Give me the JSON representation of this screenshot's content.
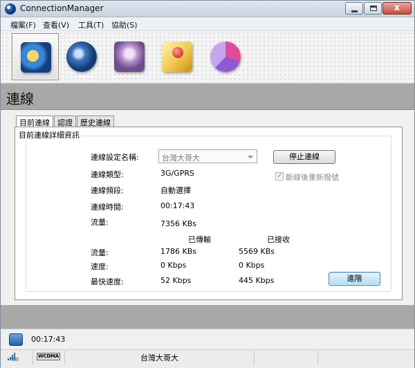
{
  "window": {
    "title": "ConnectionManager",
    "controls": {
      "close": "x"
    }
  },
  "menu": [
    "檔案(F)",
    "查看(V)",
    "工具(T)",
    "協助(S)"
  ],
  "toolbar": [
    "connection-icon",
    "authentication-icon",
    "users-icon",
    "history-icon",
    "statistics-icon"
  ],
  "section": {
    "title": "連線"
  },
  "tabs": [
    "目前連線",
    "認證",
    "歷史連線"
  ],
  "details": {
    "group_title": "目前連線詳細資訊",
    "profile_label": "連線設定名稱:",
    "profile_value": "台灣大哥大",
    "stop_button": "停止連線",
    "reconnect_label": "斷線後重新撥號",
    "type_label": "連線類型:",
    "type_value": "3G/GPRS",
    "band_label": "連線頻段:",
    "band_value": "自動選擇",
    "time_label": "連線時間:",
    "time_value": "00:17:43",
    "traffic_label": "流量:",
    "traffic_value": "7356 KBs",
    "sent_header": "已傳輸",
    "received_header": "已接收",
    "rows": [
      {
        "label": "流量:",
        "sent": "1786 KBs",
        "received": "5569 KBs"
      },
      {
        "label": "速度:",
        "sent": "0 Kbps",
        "received": "0 Kbps"
      },
      {
        "label": "最快速度:",
        "sent": "52 Kbps",
        "received": "445 Kbps"
      }
    ],
    "advanced_button": "進階"
  },
  "status": {
    "time": "00:17:43",
    "signal_label": "Y.ill",
    "network_badge": "WCDMA",
    "carrier": "台灣大哥大"
  }
}
